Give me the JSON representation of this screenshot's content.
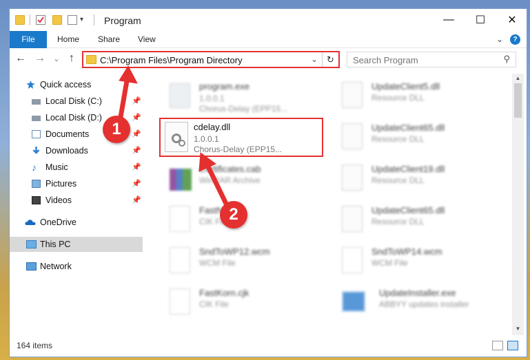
{
  "window": {
    "title": "Program",
    "minimize": "—",
    "maximize": "☐",
    "close": "✕"
  },
  "ribbon": {
    "tabs": [
      "File",
      "Home",
      "Share",
      "View"
    ],
    "expand_glyph": "⌄",
    "help_glyph": "?"
  },
  "nav": {
    "back": "←",
    "forward": "→",
    "recent": "⌄",
    "up": "↑",
    "address": "C:\\Program Files\\Program Directory",
    "address_dropdown": "⌄",
    "refresh": "↻",
    "search_placeholder": "Search Program",
    "search_glyph": "⚲"
  },
  "sidebar": {
    "items": [
      {
        "label": "Quick access",
        "icon": "star-icon"
      },
      {
        "label": "Local Disk (C:)",
        "icon": "drive-icon",
        "pinned": true
      },
      {
        "label": "Local Disk (D:)",
        "icon": "drive-icon",
        "pinned": true
      },
      {
        "label": "Documents",
        "icon": "documents-icon",
        "pinned": true
      },
      {
        "label": "Downloads",
        "icon": "download-icon",
        "pinned": true
      },
      {
        "label": "Music",
        "icon": "music-icon",
        "pinned": true
      },
      {
        "label": "Pictures",
        "icon": "pictures-icon",
        "pinned": true
      },
      {
        "label": "Videos",
        "icon": "videos-icon",
        "pinned": true
      },
      {
        "label": "OneDrive",
        "icon": "cloud-icon"
      },
      {
        "label": "This PC",
        "icon": "computer-icon",
        "selected": true
      },
      {
        "label": "Network",
        "icon": "network-icon"
      }
    ],
    "pin_glyph": "📌"
  },
  "files": [
    {
      "name": "program.exe",
      "version": "1.0.0.1",
      "desc": "Chorus-Delay (EPP15...",
      "icon": "exe-icon"
    },
    {
      "name": "cdelay.dll",
      "version": "1.0.0.1",
      "desc": "Chorus-Delay (EPP15...",
      "icon": "dll-icon",
      "highlighted": true
    },
    {
      "name": "Certificates.cab",
      "version": "",
      "desc": "WinRAR Archive",
      "icon": "archive-icon"
    },
    {
      "name": "FastNo...",
      "version": "",
      "desc": "CIK File",
      "icon": "file-icon"
    },
    {
      "name": "SndToWP12.wcm",
      "version": "",
      "desc": "WCM File",
      "icon": "file-icon"
    },
    {
      "name": "FastKorn.cjk",
      "version": "",
      "desc": "CIK File",
      "icon": "file-icon"
    },
    {
      "name": "UpdateClient5.dll",
      "version": "",
      "desc": "Resource DLL",
      "icon": "dll-icon"
    },
    {
      "name": "UpdateClient65.dll",
      "version": "",
      "desc": "Resource DLL",
      "icon": "dll-icon"
    },
    {
      "name": "UpdateClient19.dll",
      "version": "",
      "desc": "Resource DLL",
      "icon": "dll-icon"
    },
    {
      "name": "UpdateClient65.dll",
      "version": "",
      "desc": "Resource DLL",
      "icon": "dll-icon"
    },
    {
      "name": "SndToWP14.wcm",
      "version": "",
      "desc": "WCM File",
      "icon": "file-icon"
    },
    {
      "name": "UpdateInstaller.exe",
      "version": "",
      "desc": "ABBYY updates installer",
      "icon": "installer-icon"
    }
  ],
  "status": {
    "count": "164 items"
  },
  "callouts": [
    "1",
    "2"
  ],
  "colors": {
    "accent": "#1979ca",
    "highlight": "#e53030"
  }
}
